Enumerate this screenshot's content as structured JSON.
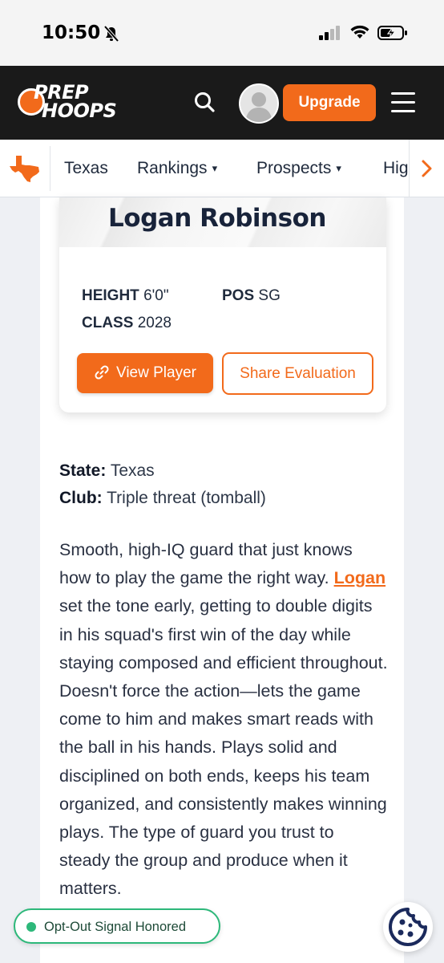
{
  "status_bar": {
    "time": "10:50"
  },
  "header": {
    "logo_line1": "PREP",
    "logo_line2": "HOOPS",
    "upgrade_label": "Upgrade"
  },
  "nav": {
    "items": [
      {
        "label": "Texas"
      },
      {
        "label": "Rankings"
      },
      {
        "label": "Prospects"
      },
      {
        "label": "Hig"
      }
    ],
    "chevron": "⌄"
  },
  "player_card": {
    "name": "Logan Robinson",
    "height_label": "HEIGHT",
    "height_value": "6'0\"",
    "pos_label": "POS",
    "pos_value": "SG",
    "class_label": "CLASS",
    "class_value": "2028",
    "view_label": "View Player",
    "share_label": "Share Evaluation"
  },
  "info": {
    "state_label": "State:",
    "state_value": "Texas",
    "club_label": "Club:",
    "club_value": "Triple threat (tomball)"
  },
  "evaluation": {
    "before_link": "Smooth, high-IQ guard that just knows how to play the game the right way. ",
    "link_text": "Logan",
    "after_link": " set the tone early, getting to double digits in his squad's first win of the day while staying composed and efficient throughout. Doesn't force the action—lets the game come to him and makes smart reads with the ball in his hands. Plays solid and disciplined on both ends, keeps his team organized, and consistently makes winning plays. The type of guard you trust to steady the group and produce when it matters."
  },
  "privacy": {
    "optout_label": "Opt-Out Signal Honored"
  },
  "colors": {
    "brand_orange": "#f26a1b",
    "header_bg": "#1a1a1a",
    "optout_green": "#2db87a",
    "cookie_navy": "#1b2a5c"
  }
}
